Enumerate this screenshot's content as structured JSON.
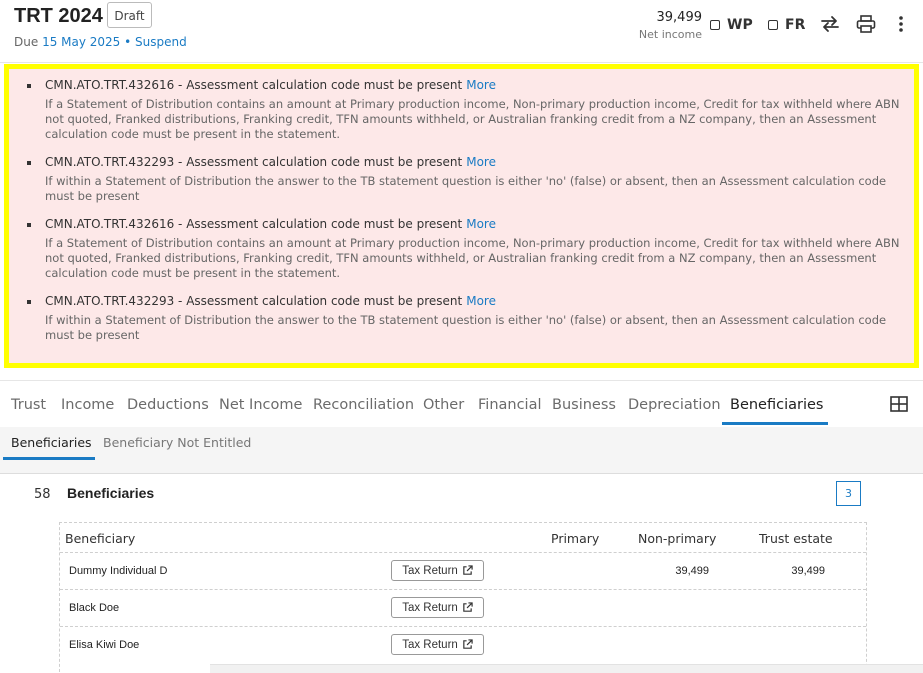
{
  "header": {
    "title": "TRT 2024",
    "status_badge": "Draft",
    "due_prefix": "Due",
    "due_date": "15 May 2025",
    "separator": "•",
    "suspend_label": "Suspend",
    "net_income_value": "39,499",
    "net_income_label": "Net income",
    "wp_label": "WP",
    "fr_label": "FR",
    "icons": [
      "swap-arrows-icon",
      "print-icon",
      "more-vertical-icon"
    ]
  },
  "errors": [
    {
      "code_text": "CMN.ATO.TRT.432616 - Assessment calculation code must be present",
      "more_label": "More",
      "description": "If a Statement of Distribution contains an amount at Primary production income, Non-primary production income, Credit for tax withheld where ABN not quoted, Franked distributions, Franking credit, TFN amounts withheld, or Australian franking credit from a NZ company, then an Assessment calculation code must be present in the statement."
    },
    {
      "code_text": "CMN.ATO.TRT.432293 - Assessment calculation code must be present",
      "more_label": "More",
      "description": "If within a Statement of Distribution the answer to the TB statement question is either 'no' (false) or absent, then an Assessment calculation code must be present"
    },
    {
      "code_text": "CMN.ATO.TRT.432616 - Assessment calculation code must be present",
      "more_label": "More",
      "description": "If a Statement of Distribution contains an amount at Primary production income, Non-primary production income, Credit for tax withheld where ABN not quoted, Franked distributions, Franking credit, TFN amounts withheld, or Australian franking credit from a NZ company, then an Assessment calculation code must be present in the statement."
    },
    {
      "code_text": "CMN.ATO.TRT.432293 - Assessment calculation code must be present",
      "more_label": "More",
      "description": "If within a Statement of Distribution the answer to the TB statement question is either 'no' (false) or absent, then an Assessment calculation code must be present"
    }
  ],
  "tabs": [
    {
      "label": "Trust"
    },
    {
      "label": "Income"
    },
    {
      "label": "Deductions"
    },
    {
      "label": "Net Income"
    },
    {
      "label": "Reconciliation"
    },
    {
      "label": "Other"
    },
    {
      "label": "Financial"
    },
    {
      "label": "Business"
    },
    {
      "label": "Depreciation"
    },
    {
      "label": "Beneficiaries",
      "active": true
    }
  ],
  "subtabs": [
    {
      "label": "Beneficiaries",
      "active": true
    },
    {
      "label": "Beneficiary Not Entitled"
    }
  ],
  "section": {
    "number": "58",
    "title": "Beneficiaries",
    "count": "3"
  },
  "table": {
    "headers": [
      "Beneficiary",
      "Primary",
      "Non-primary",
      "Trust estate"
    ],
    "tax_return_label": "Tax Return",
    "rows": [
      {
        "name": "Dummy Individual D",
        "primary": "",
        "non_primary": "39,499",
        "trust_estate": "39,499"
      },
      {
        "name": "Black Doe",
        "primary": "",
        "non_primary": "",
        "trust_estate": ""
      },
      {
        "name": "Elisa Kiwi Doe",
        "primary": "",
        "non_primary": "",
        "trust_estate": ""
      }
    ]
  },
  "colors": {
    "accent": "#1a7bc4",
    "error_background": "#fde8e8",
    "highlight_border": "#ffff00"
  }
}
